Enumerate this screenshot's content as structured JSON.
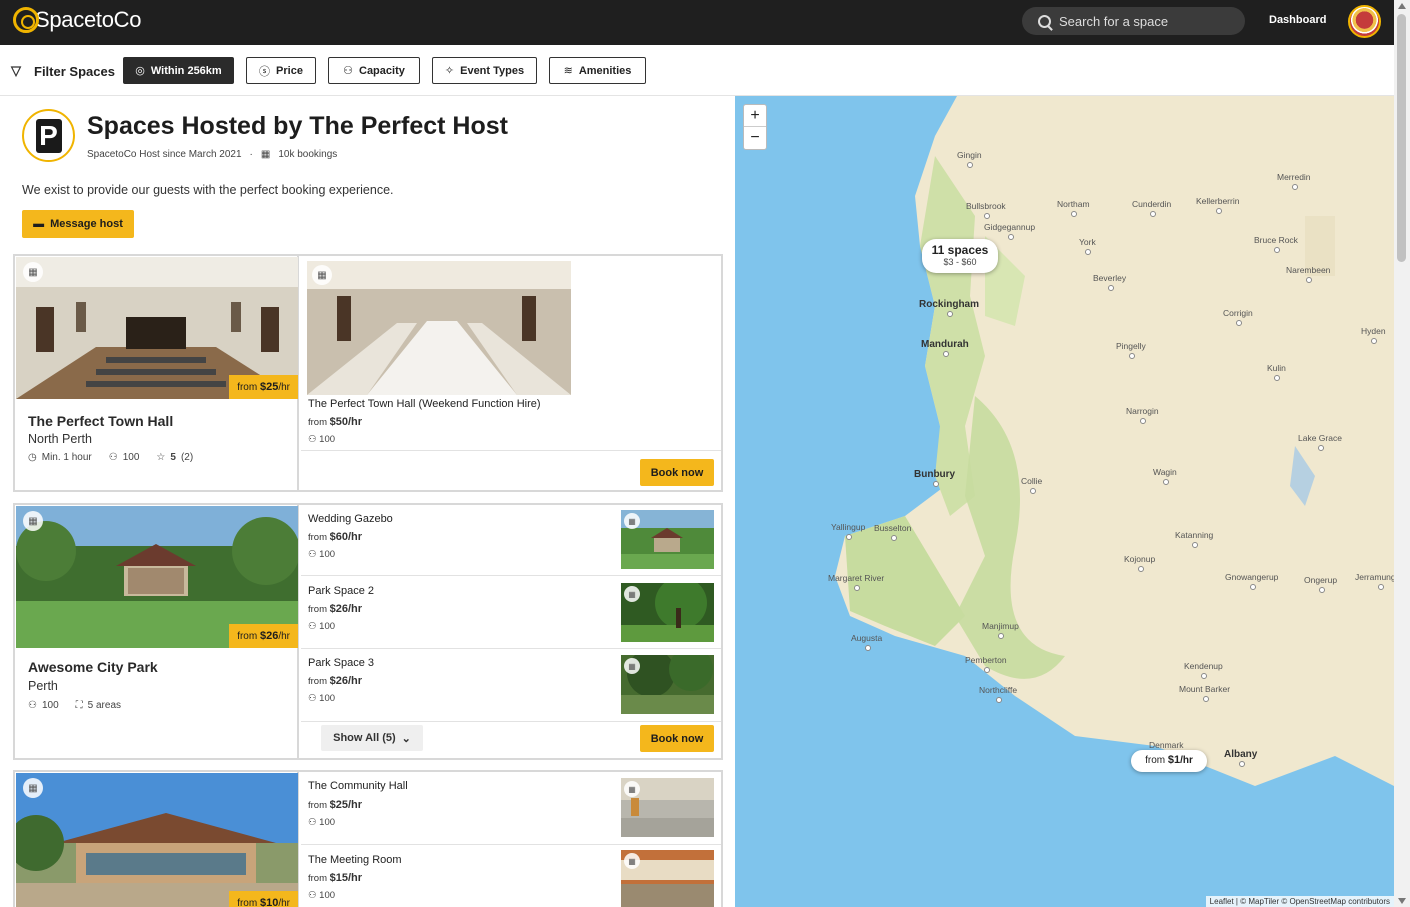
{
  "header": {
    "logo_text": "SpacetoCo",
    "search_placeholder": "Search for a space",
    "dashboard_label": "Dashboard"
  },
  "filters": {
    "label": "Filter Spaces",
    "chips": [
      {
        "label": "Within 256km",
        "icon": "radius-icon",
        "active": true
      },
      {
        "label": "Price",
        "icon": "dollar-icon",
        "active": false
      },
      {
        "label": "Capacity",
        "icon": "people-icon",
        "active": false
      },
      {
        "label": "Event Types",
        "icon": "party-icon",
        "active": false
      },
      {
        "label": "Amenities",
        "icon": "wifi-icon",
        "active": false
      }
    ]
  },
  "host": {
    "title": "Spaces Hosted by The Perfect Host",
    "since": "SpacetoCo Host since March 2021",
    "bookings": "10k bookings",
    "description": "We exist to provide our guests with the perfect booking experience.",
    "message_label": "Message host"
  },
  "venues": [
    {
      "name": "The Perfect Town Hall",
      "location": "North Perth",
      "price_from": "from",
      "price": "$25",
      "price_unit": "/hr",
      "min_hours": "Min. 1 hour",
      "capacity": "100",
      "rating": "5",
      "reviews": "(2)",
      "spaces": [
        {
          "name": "The Perfect Town Hall (Weekend Function Hire)",
          "from": "from",
          "price": "$50",
          "unit": "/hr",
          "capacity": "100"
        }
      ],
      "book_label": "Book now"
    },
    {
      "name": "Awesome City Park",
      "location": "Perth",
      "price_from": "from",
      "price": "$26",
      "price_unit": "/hr",
      "capacity": "100",
      "areas": "5 areas",
      "spaces": [
        {
          "name": "Wedding Gazebo",
          "from": "from",
          "price": "$60",
          "unit": "/hr",
          "capacity": "100"
        },
        {
          "name": "Park Space 2",
          "from": "from",
          "price": "$26",
          "unit": "/hr",
          "capacity": "100"
        },
        {
          "name": "Park Space 3",
          "from": "from",
          "price": "$26",
          "unit": "/hr",
          "capacity": "100"
        }
      ],
      "show_all": "Show All (5)",
      "book_label": "Book now"
    },
    {
      "name": "",
      "price_from": "from",
      "price": "$10",
      "price_unit": "/hr",
      "spaces": [
        {
          "name": "The Community Hall",
          "from": "from",
          "price": "$25",
          "unit": "/hr",
          "capacity": "100"
        },
        {
          "name": "The Meeting Room",
          "from": "from",
          "price": "$15",
          "unit": "/hr",
          "capacity": "100"
        }
      ]
    }
  ],
  "map": {
    "zoom_in": "+",
    "zoom_out": "−",
    "cluster_count": "11 spaces",
    "cluster_range": "$3 - $60",
    "pin_from": "from",
    "pin_price": "$1",
    "pin_unit": "/hr",
    "attribution": "Leaflet | © MapTiler © OpenStreetMap contributors",
    "towns": [
      "Gingin",
      "Bullsbrook",
      "Gidgegannup",
      "Northam",
      "Cunderdin",
      "Kellerberrin",
      "Merredin",
      "York",
      "Bruce Rock",
      "Beverley",
      "Narembeen",
      "Rockingham",
      "Mandurah",
      "Pingelly",
      "Corrigin",
      "Hyden",
      "Kulin",
      "Narrogin",
      "Lake Grace",
      "Bunbury",
      "Collie",
      "Wagin",
      "Yallingup",
      "Busselton",
      "Katanning",
      "Margaret River",
      "Kojonup",
      "Gnowangerup",
      "Ongerup",
      "Jerramungup",
      "Augusta",
      "Manjimup",
      "Pemberton",
      "Kendenup",
      "Northcliffe",
      "Mount Barker",
      "Denmark",
      "Albany"
    ]
  }
}
